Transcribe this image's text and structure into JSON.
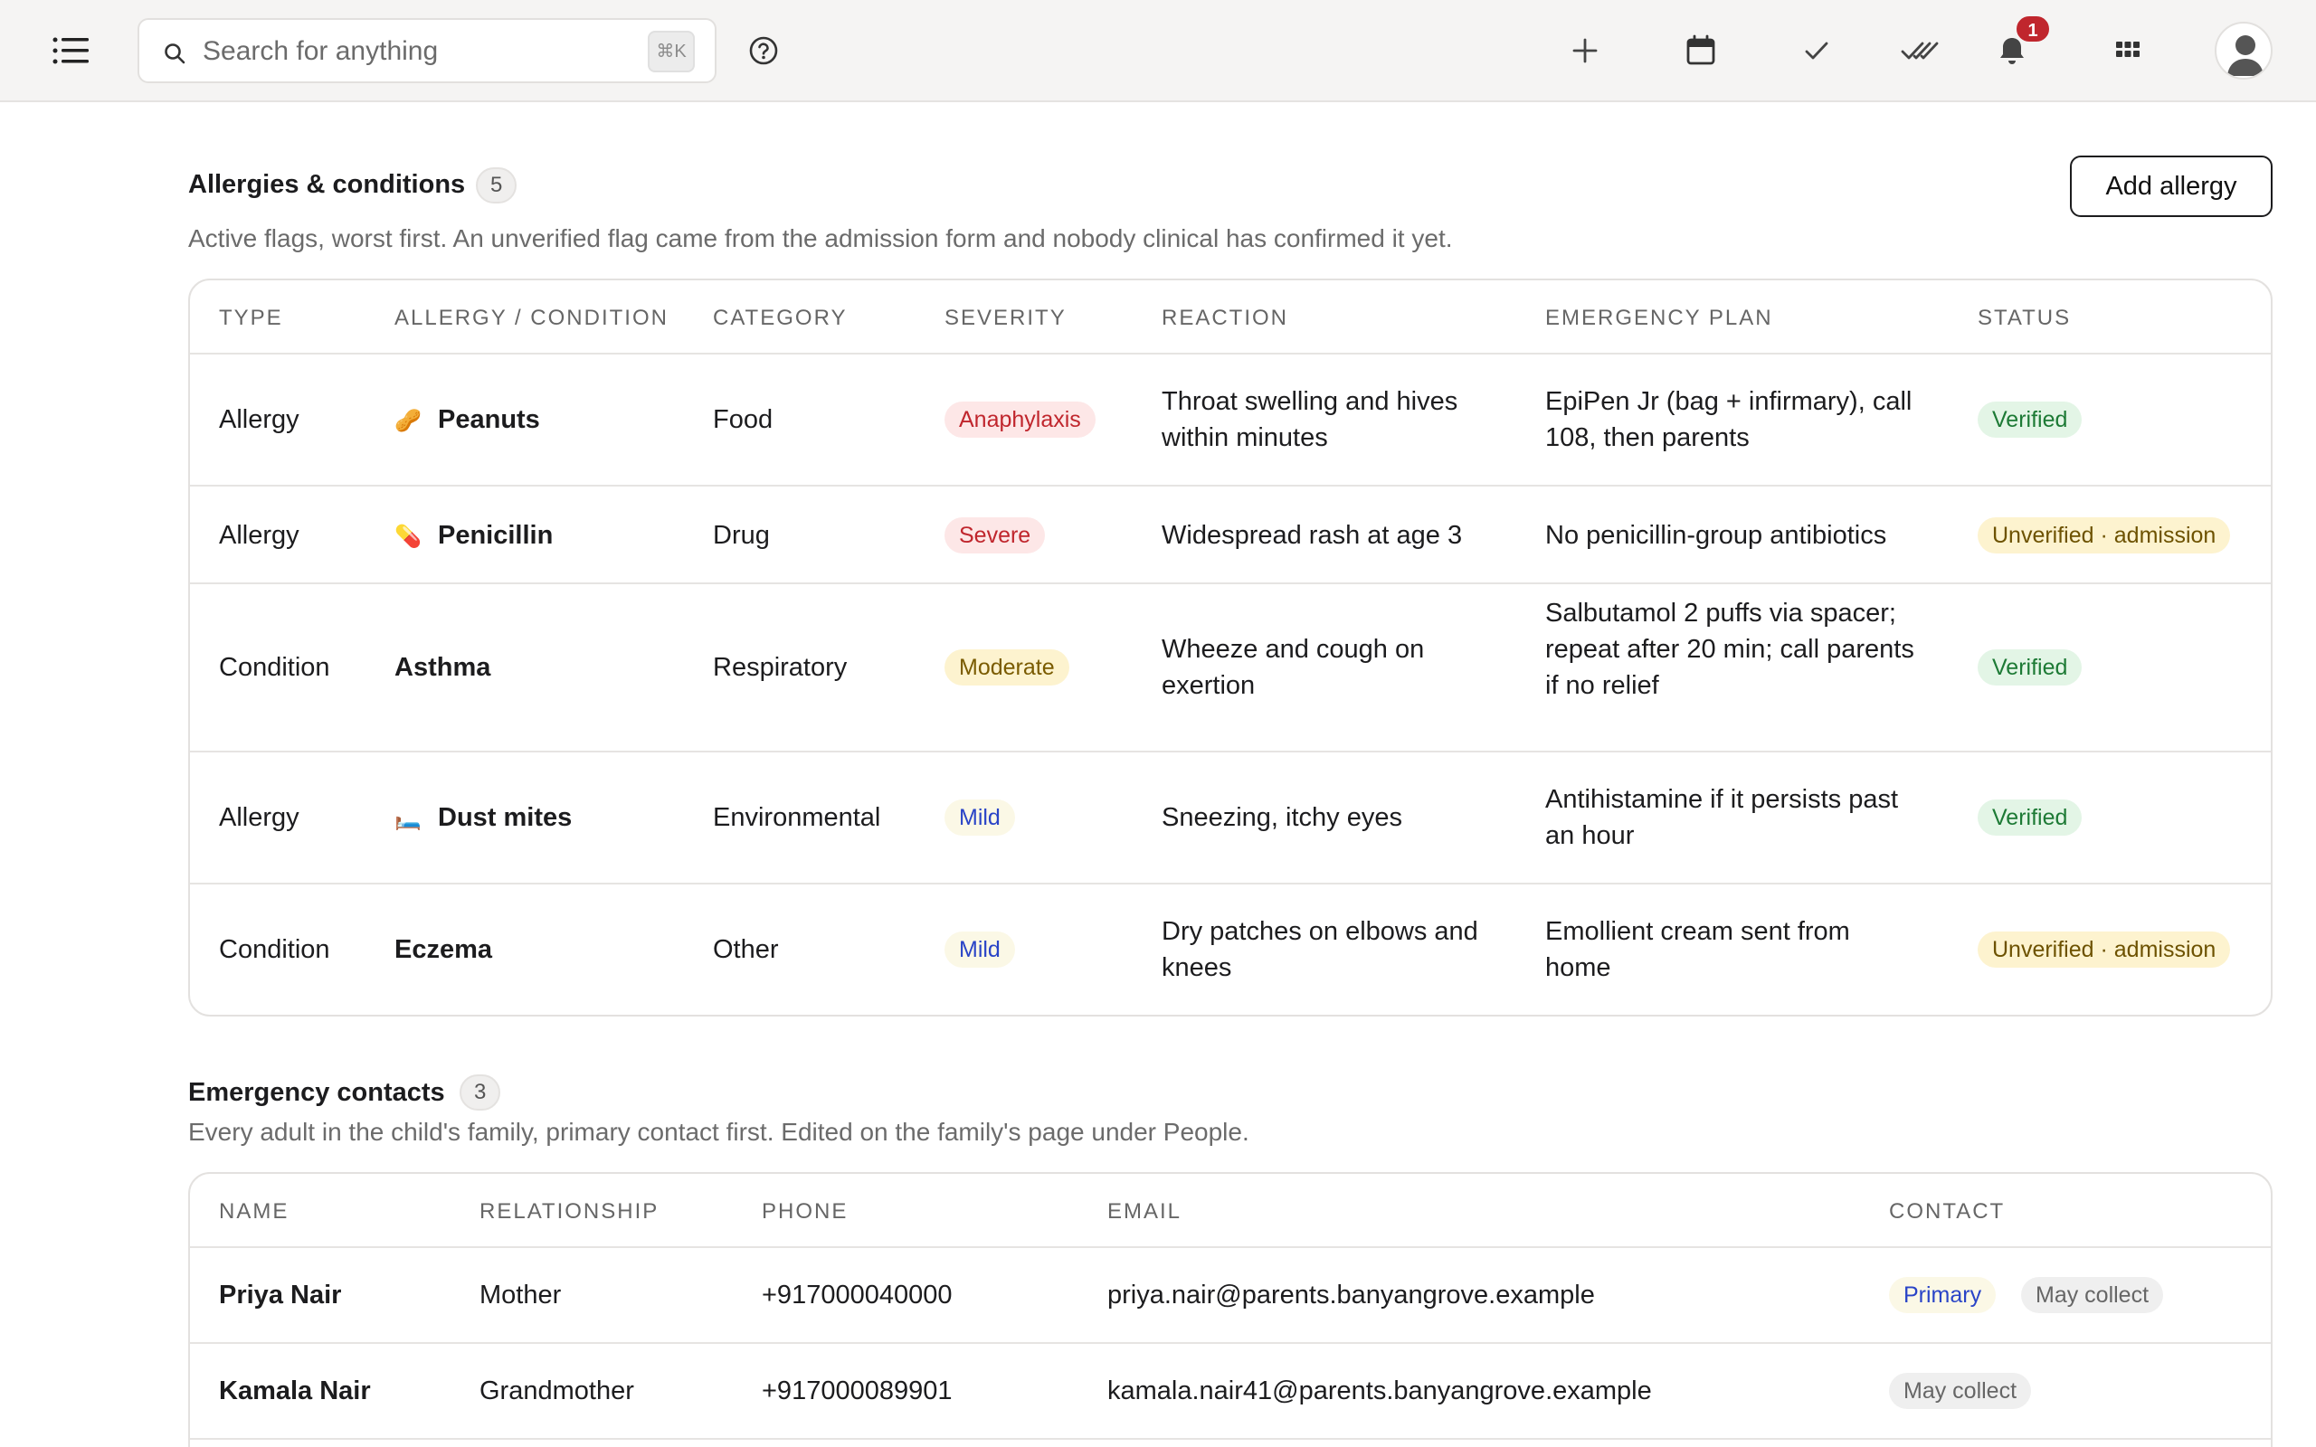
{
  "topbar": {
    "search_placeholder": "Search for anything",
    "search_shortcut": "⌘K",
    "notification_count": "1",
    "icons": [
      "menu-icon",
      "search-icon",
      "help-icon",
      "plus-icon",
      "calendar-icon",
      "check-icon",
      "double-check-icon",
      "bell-icon",
      "apps-grid-icon",
      "user-avatar-icon"
    ]
  },
  "allergies": {
    "title": "Allergies & conditions",
    "count": "5",
    "description": "Active flags, worst first. An unverified flag came from the admission form and nobody clinical has confirmed it yet.",
    "add_button": "Add allergy",
    "columns": [
      "TYPE",
      "ALLERGY / CONDITION",
      "CATEGORY",
      "SEVERITY",
      "REACTION",
      "EMERGENCY PLAN",
      "STATUS"
    ],
    "rows": [
      {
        "type": "Allergy",
        "emoji": "🥜",
        "name": "Peanuts",
        "category": "Food",
        "severity": "Anaphylaxis",
        "reaction": "Throat swelling and hives within minutes",
        "plan": "EpiPen Jr (bag + infirmary), call 108, then parents",
        "status": "Verified"
      },
      {
        "type": "Allergy",
        "emoji": "💊",
        "name": "Penicillin",
        "category": "Drug",
        "severity": "Severe",
        "reaction": "Widespread rash at age 3",
        "plan": "No penicillin‑group antibiotics",
        "status": "Unverified · admission"
      },
      {
        "type": "Condition",
        "emoji": "",
        "name": "Asthma",
        "category": "Respiratory",
        "severity": "Moderate",
        "reaction": "Wheeze and cough on exertion",
        "plan": "Salbutamol 2 puffs via spacer; repeat after 20 min; call parents if no relief",
        "status": "Verified"
      },
      {
        "type": "Allergy",
        "emoji": "🛏️",
        "name": "Dust mites",
        "category": "Environmental",
        "severity": "Mild",
        "reaction": "Sneezing, itchy eyes",
        "plan": "Antihistamine if it persists past an hour",
        "status": "Verified"
      },
      {
        "type": "Condition",
        "emoji": "",
        "name": "Eczema",
        "category": "Other",
        "severity": "Mild",
        "reaction": "Dry patches on elbows and knees",
        "plan": "Emollient cream sent from home",
        "status": "Unverified · admission"
      }
    ]
  },
  "contacts": {
    "title": "Emergency contacts",
    "count": "3",
    "description": "Every adult in the child's family, primary contact first. Edited on the family's page under People.",
    "columns": [
      "NAME",
      "RELATIONSHIP",
      "PHONE",
      "EMAIL",
      "CONTACT"
    ],
    "rows": [
      {
        "name": "Priya Nair",
        "relationship": "Mother",
        "phone": "+917000040000",
        "email": "priya.nair@parents.banyangrove.example",
        "tags": [
          "Primary",
          "May collect"
        ]
      },
      {
        "name": "Kamala Nair",
        "relationship": "Grandmother",
        "phone": "+917000089901",
        "email": "kamala.nair41@parents.banyangrove.example",
        "tags": [
          "May collect"
        ]
      }
    ]
  }
}
